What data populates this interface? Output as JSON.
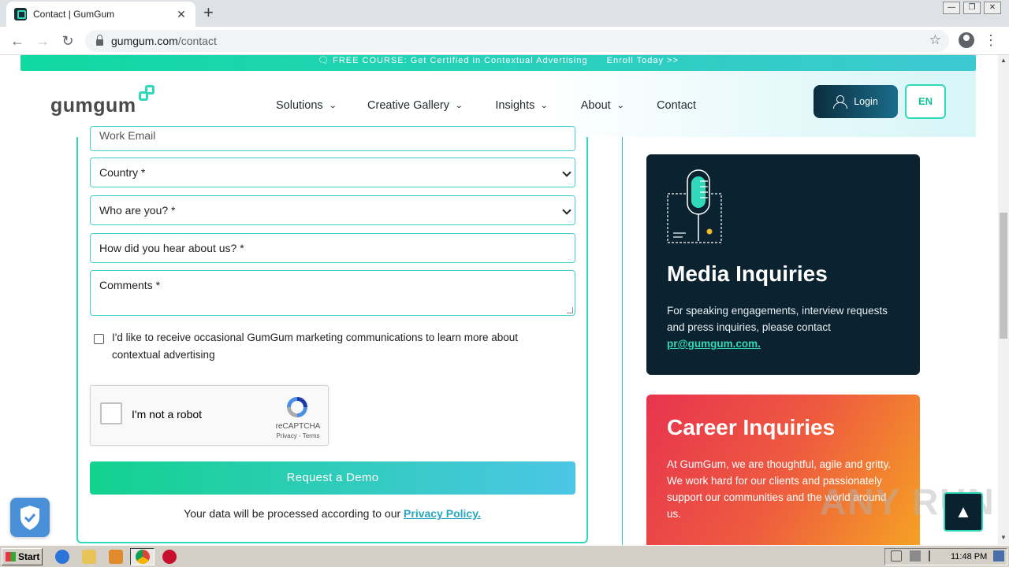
{
  "browser": {
    "tab_title": "Contact | GumGum",
    "url_host": "gumgum.com",
    "url_path": "/contact",
    "window_buttons": [
      "—",
      "❐",
      "✕"
    ]
  },
  "promo_banner": {
    "text": "🗨 FREE COURSE: Get Certified in Contextual Advertising",
    "link": "Enroll Today >>"
  },
  "header": {
    "logo_text": "gumgum",
    "nav": [
      {
        "label": "Solutions",
        "has_dropdown": true
      },
      {
        "label": "Creative Gallery",
        "has_dropdown": true
      },
      {
        "label": "Insights",
        "has_dropdown": true
      },
      {
        "label": "About",
        "has_dropdown": true
      },
      {
        "label": "Contact",
        "has_dropdown": false
      }
    ],
    "login_label": "Login",
    "language_label": "EN"
  },
  "form": {
    "work_email_placeholder": "Work Email",
    "country_placeholder": "Country *",
    "who_are_you_placeholder": "Who are you? *",
    "hear_about_placeholder": "How did you hear about us? *",
    "comments_placeholder": "Comments *",
    "marketing_consent": "I'd like to receive occasional GumGum marketing communications to learn more about contextual advertising",
    "recaptcha_label": "I'm not a robot",
    "recaptcha_brand": "reCAPTCHA",
    "recaptcha_terms": "Privacy - Terms",
    "submit_label": "Request a Demo",
    "privacy_prefix": "Your data will be processed according to our",
    "privacy_link": "Privacy Policy."
  },
  "media_card": {
    "title": "Media Inquiries",
    "text": "For speaking engagements, interview requests and press inquiries, please contact",
    "email": "pr@gumgum.com."
  },
  "career_card": {
    "title": "Career Inquiries",
    "text": "At GumGum, we are thoughtful, agile and gritty. We work hard for our clients and passionately support our communities and the world around us."
  },
  "watermark": "ANY RUN",
  "taskbar": {
    "start_label": "Start",
    "clock": "11:48 PM"
  },
  "colors": {
    "accent": "#2fd9b9",
    "navy": "#0b2230",
    "career_gradient_start": "#e7344f",
    "career_gradient_end": "#f5a323"
  }
}
